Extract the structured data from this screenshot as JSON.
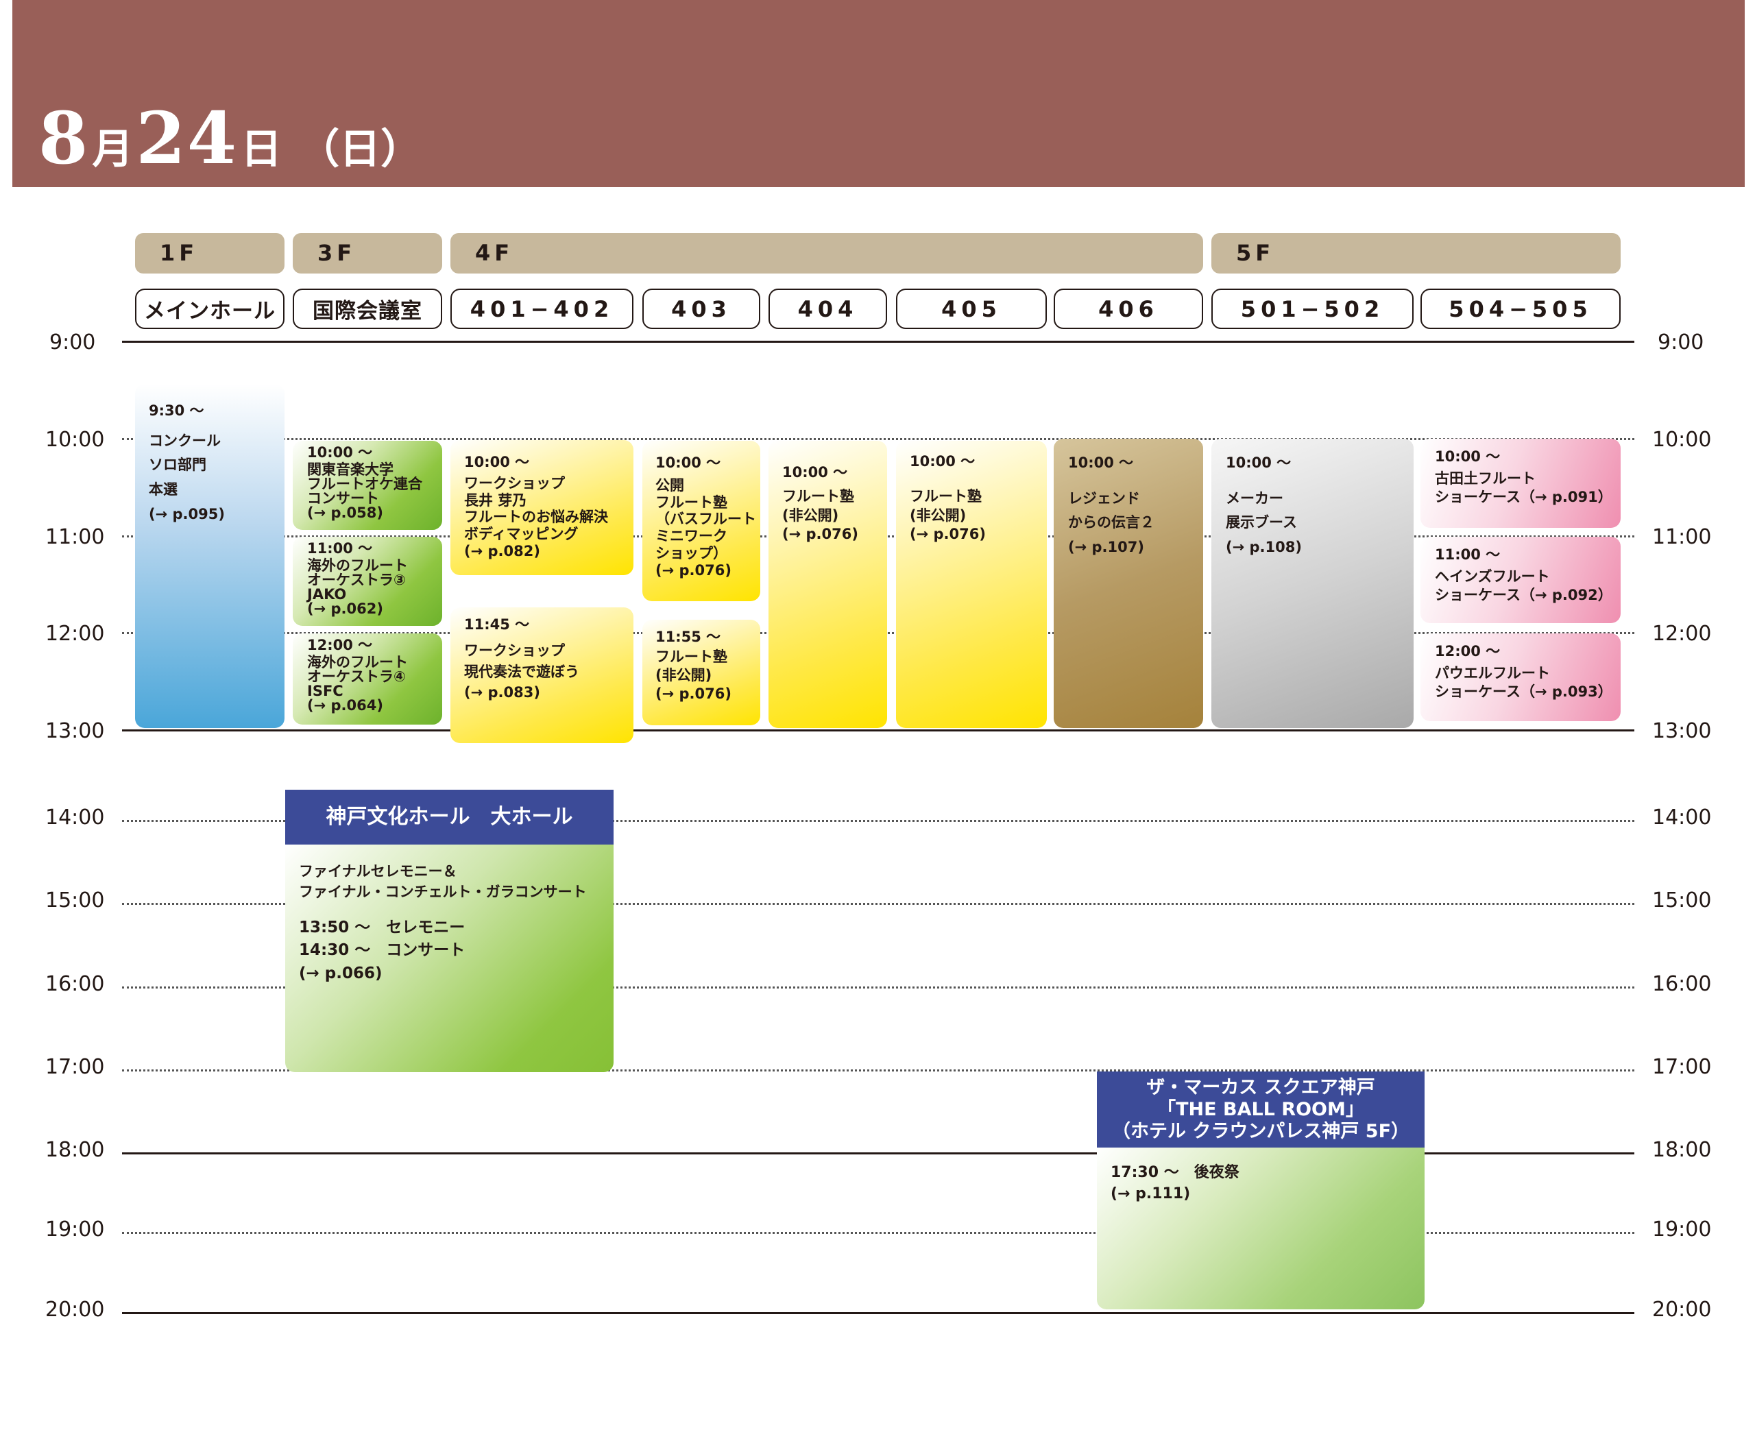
{
  "header": {
    "month_num": "8",
    "month_kanji": "月",
    "day_num": "24",
    "day_kanji": "日",
    "weekday": "（日）"
  },
  "floors": [
    "1F",
    "3F",
    "4F",
    "5F"
  ],
  "rooms": [
    "メインホール",
    "国際会議室",
    "401−402",
    "403",
    "404",
    "405",
    "406",
    "501−502",
    "504−505"
  ],
  "times": [
    "9:00",
    "10:00",
    "11:00",
    "12:00",
    "13:00",
    "14:00",
    "15:00",
    "16:00",
    "17:00",
    "18:00",
    "19:00",
    "20:00"
  ],
  "events": {
    "main_hall": [
      "9:30 〜",
      "コンクール",
      "ソロ部門",
      "本選",
      "(→ p.095)"
    ],
    "intl_1": [
      "10:00 〜",
      "関東音楽大学",
      "フルートオケ連合",
      "コンサート",
      "(→ p.058)"
    ],
    "intl_2": [
      "11:00 〜",
      "海外のフルート",
      "オーケストラ③",
      "JAKO",
      "(→ p.062)"
    ],
    "intl_3": [
      "12:00 〜",
      "海外のフルート",
      "オーケストラ④",
      "ISFC",
      "(→ p.064)"
    ],
    "r401_1": [
      "10:00 〜",
      "ワークショップ",
      "長井 芽乃",
      "フルートのお悩み解決",
      "ボディマッピング",
      "(→ p.082)"
    ],
    "r401_2": [
      "11:45 〜",
      "ワークショップ",
      "現代奏法で遊ぼう",
      "(→ p.083)"
    ],
    "r403_1": [
      "10:00 〜",
      "公開",
      "フルート塾",
      "（バスフルート",
      "ミニワーク",
      "ショップ）",
      "(→ p.076)"
    ],
    "r403_2": [
      "11:55 〜",
      "フルート塾",
      "(非公開)",
      "(→ p.076)"
    ],
    "r404": [
      "10:00 〜",
      "フルート塾",
      "(非公開)",
      "(→ p.076)"
    ],
    "r405": [
      "10:00 〜",
      "フルート塾",
      "(非公開)",
      "(→ p.076)"
    ],
    "r406": [
      "10:00 〜",
      "レジェンド",
      "からの伝言２",
      "(→ p.107)"
    ],
    "r501": [
      "10:00 〜",
      "メーカー",
      "展示ブース",
      "(→ p.108)"
    ],
    "r504_1": [
      "10:00 〜",
      "古田土フルート",
      "ショーケース（→ p.091）"
    ],
    "r504_2": [
      "11:00 〜",
      "ヘインズフルート",
      "ショーケース（→ p.092）"
    ],
    "r504_3": [
      "12:00 〜",
      "パウエルフルート",
      "ショーケース（→ p.093）"
    ]
  },
  "kobe_hall": {
    "venue": "神戸文化ホール　大ホール",
    "lines": [
      "ファイナルセレモニー＆",
      "ファイナル・コンチェルト・ガラコンサート",
      "",
      "13:50 〜　セレモニー",
      "14:30 〜　コンサート",
      "(→ p.066)"
    ]
  },
  "marcus_square": {
    "venue": [
      "ザ・マーカス スクエア神戸",
      "「THE BALL ROOM」",
      "（ホテル クラウンパレス神戸 5F）"
    ],
    "lines": [
      "17:30 〜　後夜祭",
      "(→ p.111)"
    ]
  },
  "colors": {
    "header_band": "#995f58",
    "floor_pill": "#c7b89c",
    "venue_head": "#3c4b98"
  }
}
